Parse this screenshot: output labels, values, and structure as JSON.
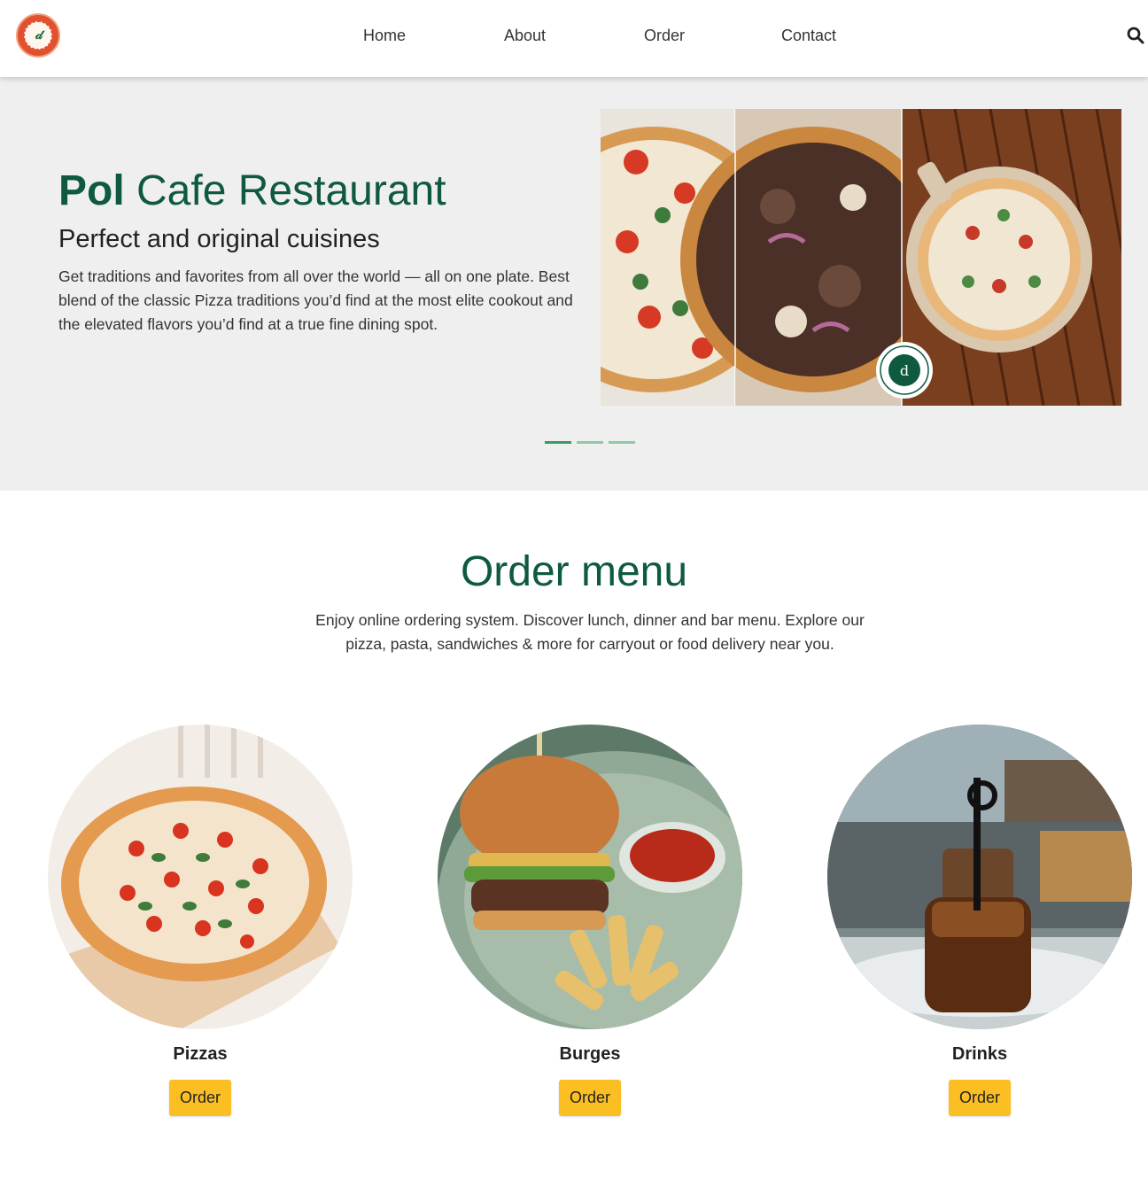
{
  "header": {
    "logo_name": "pol-cafe-logo",
    "nav": [
      {
        "label": "Home"
      },
      {
        "label": "About"
      },
      {
        "label": "Order"
      },
      {
        "label": "Contact"
      }
    ],
    "search_icon": "search-icon"
  },
  "hero": {
    "title_bold": "Pol",
    "title_light": "Cafe Restaurant",
    "subtitle": "Perfect and original cuisines",
    "text": "Get traditions and favorites from all over the world — all on one plate. Best blend of the classic Pizza traditions you’d find at the most elite cookout and the elevated flavors you’d find at a true fine dining spot.",
    "slider": {
      "slide_count": 3,
      "active_index": 0
    }
  },
  "order_menu": {
    "title": "Order menu",
    "description": "Enjoy online ordering system. Discover lunch, dinner and bar menu. Explore our pizza, pasta, sandwiches & more for carryout or food delivery near you.",
    "items": [
      {
        "name": "Pizzas",
        "button": "Order"
      },
      {
        "name": "Burges",
        "button": "Order"
      },
      {
        "name": "Drinks",
        "button": "Order"
      }
    ]
  },
  "colors": {
    "brand_green": "#0f5a3f",
    "accent_yellow": "#fbbf24",
    "hero_bg": "#efefef",
    "dot_active": "#3c9a63",
    "dot_inactive": "#8fcaa4",
    "logo_red": "#e1502f"
  }
}
